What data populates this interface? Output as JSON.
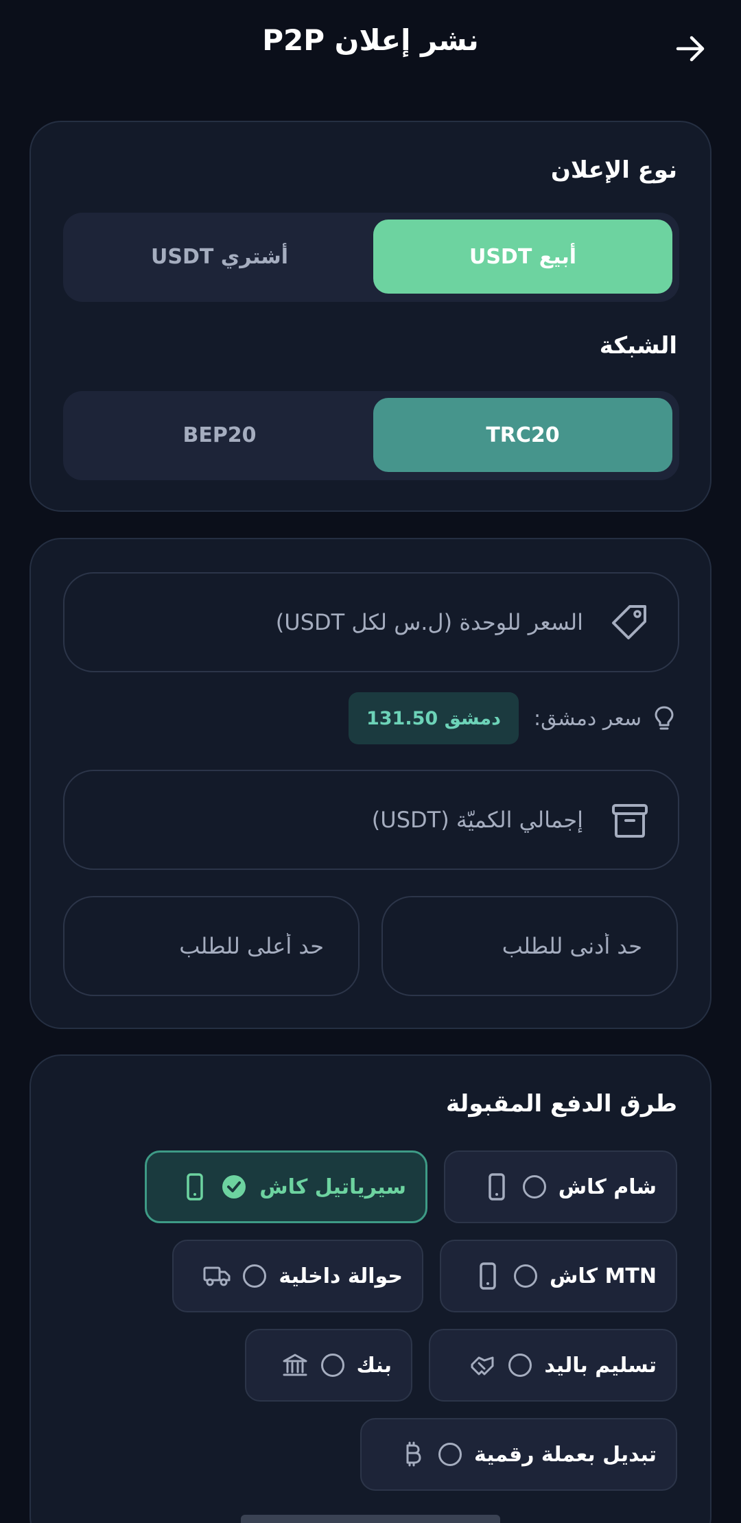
{
  "header": {
    "title": "نشر إعلان P2P",
    "back_icon": "arrow-right-icon"
  },
  "ad_type": {
    "label": "نوع الإعلان",
    "options": [
      {
        "label": "أبيع USDT",
        "selected": true
      },
      {
        "label": "أشتري USDT",
        "selected": false
      }
    ]
  },
  "network": {
    "label": "الشبكة",
    "options": [
      {
        "label": "TRC20",
        "selected": true
      },
      {
        "label": "BEP20",
        "selected": false
      }
    ]
  },
  "form": {
    "price_placeholder": "السعر للوحدة (ل.س لكل USDT)",
    "price_value": "",
    "damascus_label": "سعر دمشق:",
    "damascus_badge": "دمشق 131.50",
    "quantity_placeholder": "إجمالي الكميّة (USDT)",
    "quantity_value": "",
    "min_placeholder": "حد أدنى للطلب",
    "max_placeholder": "حد أعلى للطلب"
  },
  "payment": {
    "label": "طرق الدفع المقبولة",
    "methods": [
      {
        "label": "شام كاش",
        "icon": "phone-icon",
        "selected": false
      },
      {
        "label": "سيرياتيل كاش",
        "icon": "phone-icon",
        "selected": true
      },
      {
        "label": "MTN كاش",
        "icon": "phone-icon",
        "selected": false
      },
      {
        "label": "حوالة داخلية",
        "icon": "truck-icon",
        "selected": false
      },
      {
        "label": "تسليم باليد",
        "icon": "handshake-icon",
        "selected": false
      },
      {
        "label": "بنك",
        "icon": "bank-icon",
        "selected": false
      },
      {
        "label": "تبديل بعملة رقمية",
        "icon": "bitcoin-icon",
        "selected": false
      }
    ]
  },
  "colors": {
    "background": "#0b0f1a",
    "card": "#131a29",
    "sell_active": "#6dd3a0",
    "network_active": "#46958c",
    "accent_text": "#6dd3b8"
  }
}
